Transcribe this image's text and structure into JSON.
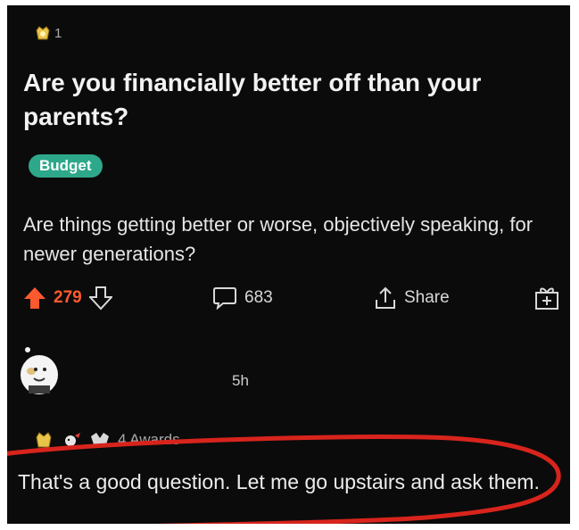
{
  "post": {
    "award_count": "1",
    "award_icon": "gold-award-icon",
    "title": "Are you financially better off than your parents?",
    "flair": "Budget",
    "flair_color": "#2ea88a",
    "body": "Are things getting better or worse, objectively speaking, for newer generations?"
  },
  "actions": {
    "upvote_count": "279",
    "upvote_color": "#ff5a2e",
    "comment_count": "683",
    "share_label": "Share"
  },
  "comment": {
    "timestamp": "5h",
    "awards_label": "4 Awards",
    "text": "That's a good question. Let me go upstairs and ask them."
  },
  "annotation": {
    "circle_color": "#d8241c"
  }
}
